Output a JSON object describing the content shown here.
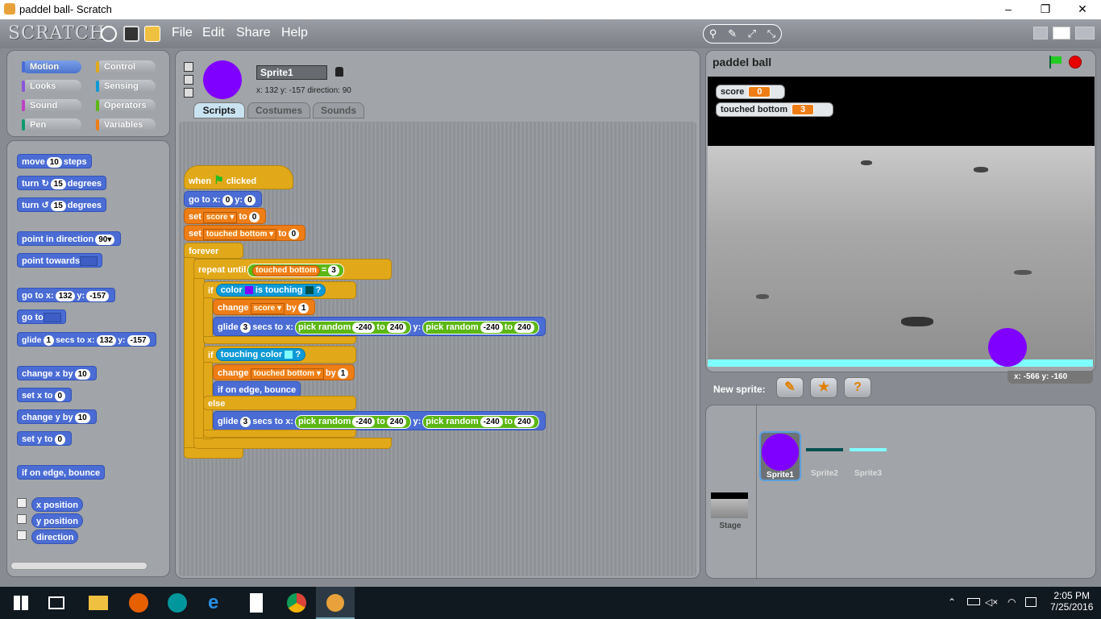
{
  "window": {
    "title": "paddel ball- Scratch",
    "min": "–",
    "max": "❐",
    "close": "✕"
  },
  "menubar": {
    "logo": "SCRATCH",
    "menus": [
      "File",
      "Edit",
      "Share",
      "Help"
    ],
    "tools": [
      "⚲",
      "✎",
      "⤢",
      "⤡"
    ]
  },
  "categories": [
    {
      "label": "Motion",
      "color": "#4a6cd4"
    },
    {
      "label": "Control",
      "color": "#e1a91a"
    },
    {
      "label": "Looks",
      "color": "#8a55d7"
    },
    {
      "label": "Sensing",
      "color": "#0e9ad6"
    },
    {
      "label": "Sound",
      "color": "#bb42c3"
    },
    {
      "label": "Operators",
      "color": "#5cb712"
    },
    {
      "label": "Pen",
      "color": "#0e9a6c"
    },
    {
      "label": "Variables",
      "color": "#ee7d16"
    }
  ],
  "palette": {
    "move": "move",
    "move_n": "10",
    "move_s": "steps",
    "turn_cw": "turn ↻",
    "turn_cw_n": "15",
    "deg": "degrees",
    "turn_ccw": "turn ↺",
    "turn_ccw_n": "15",
    "point_dir": "point in direction",
    "point_dir_n": "90▾",
    "point_towards": "point towards",
    "goto_xy": "go to x:",
    "goto_x": "132",
    "y": "y:",
    "goto_y": "-157",
    "goto": "go to",
    "glide": "glide",
    "glide_n": "1",
    "glide_s": "secs to x:",
    "glide_x": "132",
    "glide_y": "-157",
    "change_x": "change x by",
    "change_x_n": "10",
    "set_x": "set x to",
    "set_x_n": "0",
    "change_y": "change y by",
    "change_y_n": "10",
    "set_y": "set y to",
    "set_y_n": "0",
    "bounce": "if on edge, bounce",
    "xpos": "x position",
    "ypos": "y position",
    "direction": "direction"
  },
  "sprite": {
    "name": "Sprite1",
    "info": "x: 132  y: -157  direction: 90",
    "color": "#8000ff"
  },
  "tabs": [
    "Scripts",
    "Costumes",
    "Sounds"
  ],
  "script": {
    "when": "when",
    "clicked": "clicked",
    "goto": "go to x:",
    "goto_x": "0",
    "y": "y:",
    "goto_y": "0",
    "set": "set",
    "to": "to",
    "var_score": "score ▾",
    "var_tb": "touched bottom ▾",
    "zero": "0",
    "forever": "forever",
    "repeat_until": "repeat until",
    "tb_reporter": "touched bottom",
    "eq": "=",
    "three": "3",
    "if": "if",
    "color": "color",
    "is_touching": "is touching",
    "q": "?",
    "change": "change",
    "by": "by",
    "one": "1",
    "glide": "glide",
    "glide_n": "3",
    "glide_s": "secs to x:",
    "pick_random": "pick random",
    "neg240": "-240",
    "pos240": "240",
    "touching_color": "touching color",
    "bounce": "if on edge, bounce",
    "else": "else"
  },
  "stage": {
    "title": "paddel ball",
    "watchers": [
      {
        "label": "score",
        "value": "0"
      },
      {
        "label": "touched bottom",
        "value": "3"
      }
    ],
    "coords": "x: -566   y: -160"
  },
  "newsprite": {
    "label": "New sprite:"
  },
  "sprites": [
    "Sprite1",
    "Sprite2",
    "Sprite3"
  ],
  "stage_thumb": "Stage",
  "taskbar": {
    "time": "2:05 PM",
    "date": "7/25/2016"
  }
}
